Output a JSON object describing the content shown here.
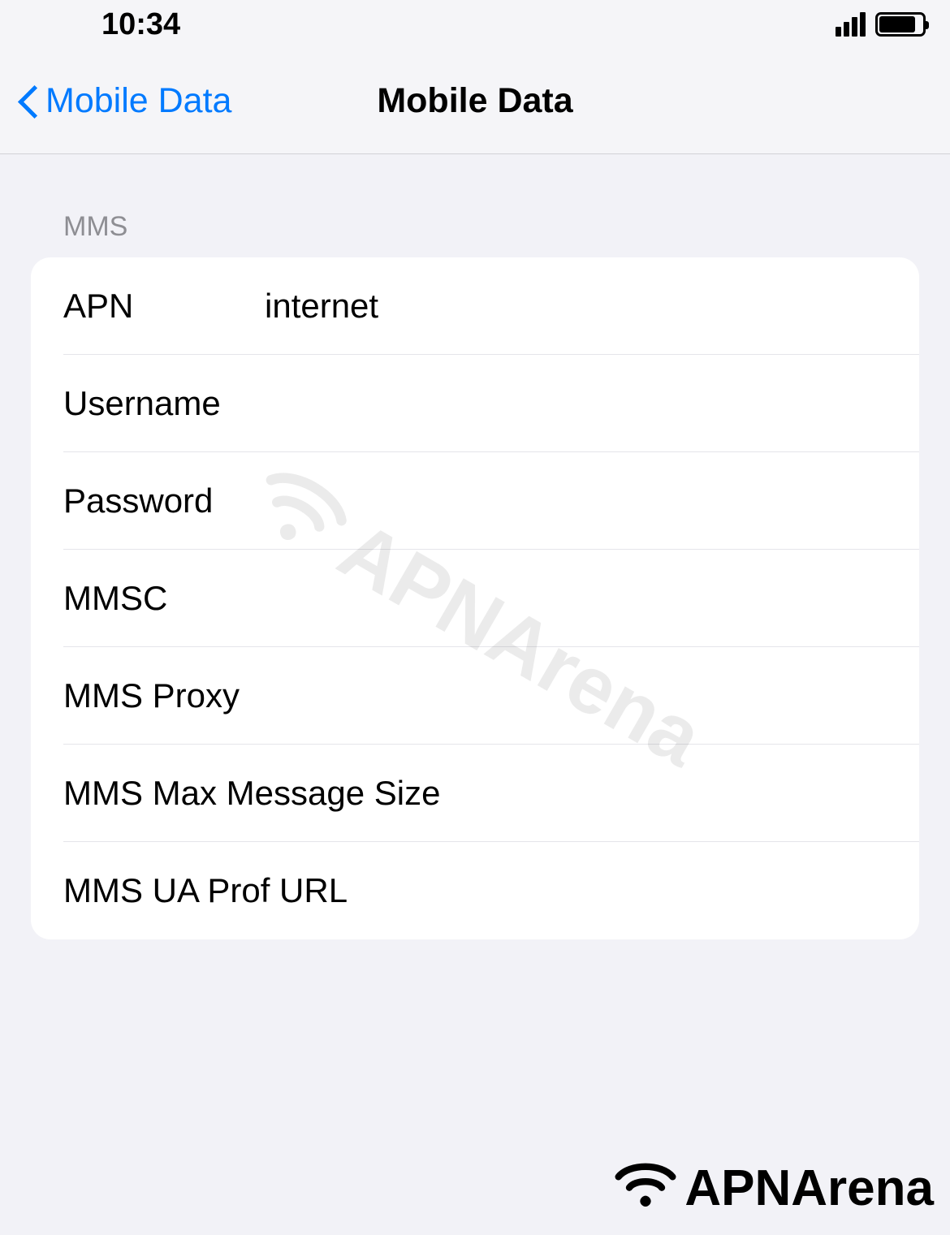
{
  "status": {
    "time": "10:34"
  },
  "nav": {
    "back_label": "Mobile Data",
    "title": "Mobile Data"
  },
  "section": {
    "header": "MMS",
    "rows": [
      {
        "label": "APN",
        "value": "internet"
      },
      {
        "label": "Username",
        "value": ""
      },
      {
        "label": "Password",
        "value": ""
      },
      {
        "label": "MMSC",
        "value": ""
      },
      {
        "label": "MMS Proxy",
        "value": ""
      },
      {
        "label": "MMS Max Message Size",
        "value": ""
      },
      {
        "label": "MMS UA Prof URL",
        "value": ""
      }
    ]
  },
  "watermark": {
    "text": "APNArena"
  },
  "footer": {
    "text": "APNArena"
  }
}
